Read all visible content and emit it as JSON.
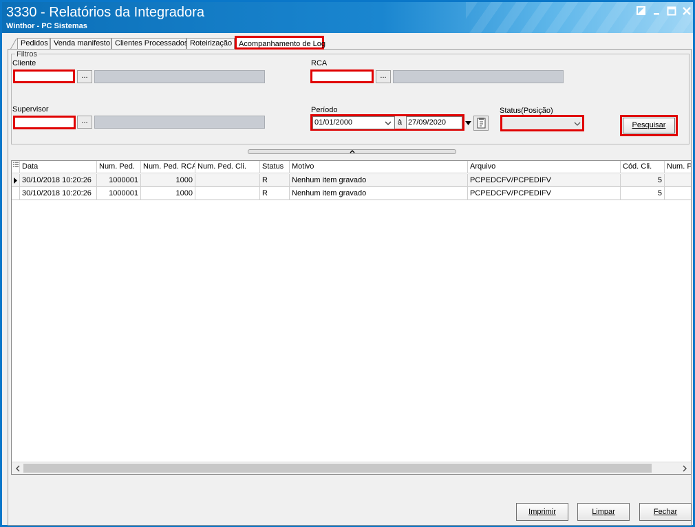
{
  "window": {
    "title": "3330 - Relatórios da Integradora",
    "subtitle": "Winthor - PC Sistemas"
  },
  "tabs": [
    {
      "label": "Pedidos"
    },
    {
      "label": "Venda manifesto"
    },
    {
      "label": "Clientes Processados"
    },
    {
      "label": "Roteirização"
    },
    {
      "label": "Acompanhamento de Log",
      "active": true
    }
  ],
  "filters": {
    "group_title": "Filtros",
    "cliente_label": "Cliente",
    "rca_label": "RCA",
    "supervisor_label": "Supervisor",
    "periodo_label": "Período",
    "status_label": "Status(Posição)",
    "lookup_button": "...",
    "date_from": "01/01/2000",
    "date_sep": "à",
    "date_to": "27/09/2020",
    "search_button": "Pesquisar"
  },
  "grid": {
    "columns": [
      "Data",
      "Num. Ped.",
      "Num. Ped. RCA",
      "Num. Ped. Cli.",
      "Status",
      "Motivo",
      "Arquivo",
      "Cód. Cli.",
      "Num. P"
    ],
    "rows": [
      [
        "30/10/2018 10:20:26",
        "1000001",
        "1000",
        "",
        "R",
        "Nenhum item gravado",
        "PCPEDCFV/PCPEDIFV",
        "5",
        ""
      ],
      [
        "30/10/2018 10:20:26",
        "1000001",
        "1000",
        "",
        "R",
        "Nenhum item gravado",
        "PCPEDCFV/PCPEDIFV",
        "5",
        ""
      ]
    ]
  },
  "footer": {
    "print_button": "Imprimir",
    "clear_button": "Limpar",
    "close_button": "Fechar"
  },
  "colors": {
    "title_bar": "#0b6fb8",
    "highlight_outline": "#e00000"
  }
}
